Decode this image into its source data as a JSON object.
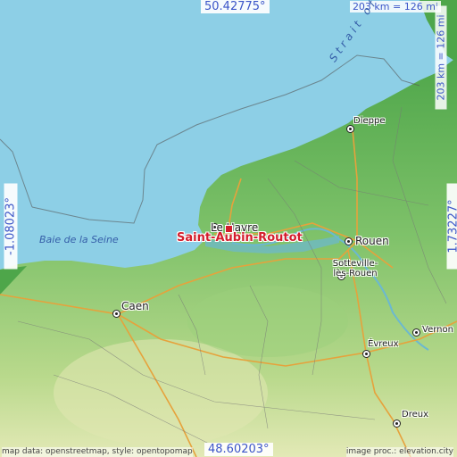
{
  "map": {
    "bounds": {
      "north": "50.42775°",
      "south": "48.60203°",
      "west": "-1.08023°",
      "east": "1.73227°"
    },
    "scale_top": "203 km = 126 mi",
    "scale_side": "203 km = 126 mi",
    "credit_left": "map data: openstreetmap, style: opentopomap",
    "credit_right": "image proc.: elevation.city",
    "target": {
      "name": "Saint-Aubin-Routot",
      "color": "#d31d2c"
    },
    "sea_labels": [
      "Baie de la Seine",
      "Strait of Dover"
    ],
    "cities": [
      {
        "name": "Le Havre"
      },
      {
        "name": "Rouen"
      },
      {
        "name": "Dieppe"
      },
      {
        "name": "Caen"
      },
      {
        "name": "Sotteville-lès-Rouen"
      },
      {
        "name": "Vernon"
      },
      {
        "name": "Évreux"
      },
      {
        "name": "Dreux"
      }
    ],
    "colors": {
      "sea": "#8dcfe6",
      "land_low": "#5fb35a",
      "land_high": "#c8dfa0",
      "roads": "#e6a23c"
    }
  }
}
